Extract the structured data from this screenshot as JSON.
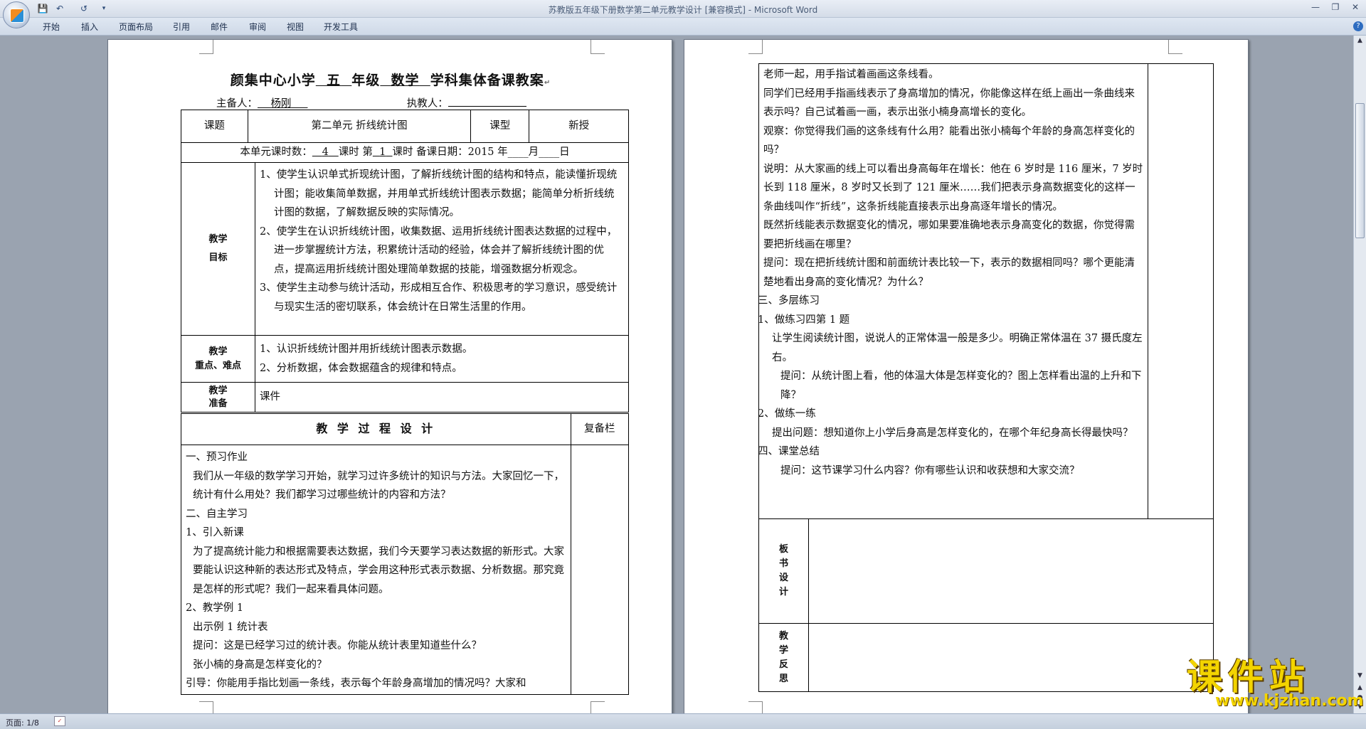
{
  "window": {
    "title": "苏教版五年级下册数学第二单元教学设计 [兼容模式] - Microsoft Word"
  },
  "ribbon": {
    "tabs": [
      "开始",
      "插入",
      "页面布局",
      "引用",
      "邮件",
      "审阅",
      "视图",
      "开发工具"
    ]
  },
  "statusbar": {
    "page": "页面: 1/8"
  },
  "page1": {
    "title_school": "颜集中心小学",
    "title_grade": "五",
    "title_grade_suffix": "年级",
    "title_subject": "数学",
    "title_suffix": "学科集体备课教案",
    "preparer_label": "主备人：",
    "preparer": "杨刚",
    "teacher_label": "执教人：",
    "teacher": "",
    "topic_label": "课题",
    "topic": "第二单元   折线统计图",
    "type_label": "课型",
    "type": "新授",
    "hours_pre": "本单元课时数：",
    "hours": "4",
    "hours_mid": "课时 第",
    "lesson": "1",
    "hours_post": "课时 备课日期：2015 年____月____日",
    "goals_label_1": "教学",
    "goals_label_2": "目标",
    "goals": [
      "1、使学生认识单式折现统计图，了解折线统计图的结构和特点，能读懂折现统计图；能收集简单数据，并用单式折线统计图表示数据；能简单分析折线统计图的数据，了解数据反映的实际情况。",
      "2、使学生在认识折线统计图，收集数据、运用折线统计图表达数据的过程中，进一步掌握统计方法，积累统计活动的经验，体会并了解折线统计图的优点，提高运用折线统计图处理简单数据的技能，增强数据分析观念。",
      "3、使学生主动参与统计活动，形成相互合作、积极思考的学习意识，感受统计与现实生活的密切联系，体会统计在日常生活里的作用。"
    ],
    "key_label_1": "教学",
    "key_label_2": "重点、难点",
    "keys": [
      "1、认识折线统计图并用折线统计图表示数据。",
      "2、分析数据，体会数据蕴含的规律和特点。"
    ],
    "prep_label_1": "教学",
    "prep_label_2": "准备",
    "prep": "课件",
    "process_title": "教  学  过  程  设  计",
    "review_label": "复备栏",
    "process": [
      "一、预习作业",
      "我们从一年级的数学学习开始，就学习过许多统计的知识与方法。大家回忆一下，统计有什么用处？我们都学习过哪些统计的内容和方法？",
      "二、自主学习",
      "1、引入新课",
      "为了提高统计能力和根据需要表达数据，我们今天要学习表达数据的新形式。大家要能认识这种新的表达形式及特点，学会用这种形式表示数据、分析数据。那究竟是怎样的形式呢？我们一起来看具体问题。",
      "2、教学例 1",
      "出示例 1 统计表",
      "提问：这是已经学习过的统计表。你能从统计表里知道些什么？",
      "张小楠的身高是怎样变化的？",
      "引导：你能用手指比划画一条线，表示每个年龄身高增加的情况吗？大家和"
    ]
  },
  "page2": {
    "process": [
      "老师一起，用手指试着画画这条线看。",
      "同学们已经用手指画线表示了身高增加的情况，你能像这样在纸上画出一条曲线来表示吗？自己试着画一画，表示出张小楠身高增长的变化。",
      "观察：你觉得我们画的这条线有什么用？能看出张小楠每个年龄的身高怎样变化的吗？",
      "说明：从大家画的线上可以看出身高每年在增长：他在 6 岁时是 116 厘米，7 岁时长到 118 厘米，8 岁时又长到了 121 厘米……我们把表示身高数据变化的这样一条曲线叫作“折线”，这条折线能直接表示出身高逐年增长的情况。",
      "既然折线能表示数据变化的情况，哪如果要准确地表示身高变化的数据，你觉得需要把折线画在哪里？",
      "提问：现在把折线统计图和前面统计表比较一下，表示的数据相同吗？哪个更能清楚地看出身高的变化情况？为什么？",
      "三、多层练习",
      "1、做练习四第 1 题",
      "让学生阅读统计图，说说人的正常体温一般是多少。明确正常体温在 37 摄氏度左右。",
      "提问：从统计图上看，他的体温大体是怎样变化的？图上怎样看出温的上升和下降？",
      "2、做练一练",
      "提出问题：想知道你上小学后身高是怎样变化的，在哪个年纪身高长得最快吗？",
      "四、课堂总结",
      "提问：这节课学习什么内容？你有哪些认识和收获想和大家交流？"
    ],
    "board_label": "板书设计",
    "reflect_label": "教学反思"
  },
  "watermark": {
    "cn": "课件站",
    "url": "www.kjzhan.com"
  }
}
